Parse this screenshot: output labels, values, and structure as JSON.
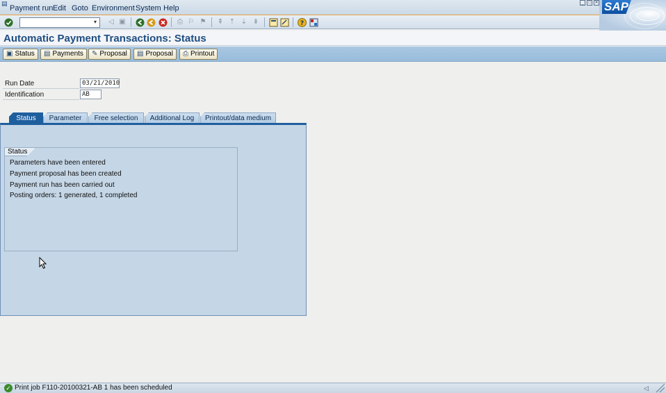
{
  "menu": {
    "items": [
      {
        "label": "Payment run"
      },
      {
        "label": "Edit"
      },
      {
        "label": "Goto"
      },
      {
        "label": "Environment"
      },
      {
        "label": "System"
      },
      {
        "label": "Help"
      }
    ]
  },
  "logo": {
    "text": "SAP"
  },
  "toolbar": {
    "command_value": ""
  },
  "page": {
    "title": "Automatic Payment Transactions: Status"
  },
  "app_toolbar": {
    "buttons": [
      {
        "label": "Status",
        "icon": "status-icon"
      },
      {
        "label": "Payments",
        "icon": "payments-icon"
      },
      {
        "label": "Proposal",
        "icon": "edit-proposal-icon"
      },
      {
        "label": "Proposal",
        "icon": "display-proposal-icon"
      },
      {
        "label": "Printout",
        "icon": "printout-icon"
      }
    ]
  },
  "fields": {
    "run_date": {
      "label": "Run Date",
      "value": "03/21/2010"
    },
    "identification": {
      "label": "Identification",
      "value": "AB"
    }
  },
  "tabs": [
    {
      "label": "Status",
      "active": true
    },
    {
      "label": "Parameter",
      "active": false
    },
    {
      "label": "Free selection",
      "active": false
    },
    {
      "label": "Additional Log",
      "active": false
    },
    {
      "label": "Printout/data medium",
      "active": false
    }
  ],
  "status_group": {
    "title": "Status",
    "lines": [
      "Parameters have been entered",
      "Payment proposal has been created",
      "Payment run has been carried out",
      "Posting orders: 1 generated, 1 completed"
    ]
  },
  "statusbar": {
    "message": "Print job F110-20100321-AB 1 has been scheduled"
  },
  "colors": {
    "title": "#1f4e82",
    "active_tab": "#1f5f9e",
    "panel": "#c5d6e6",
    "app_toolbar": "#a9c7e2"
  }
}
